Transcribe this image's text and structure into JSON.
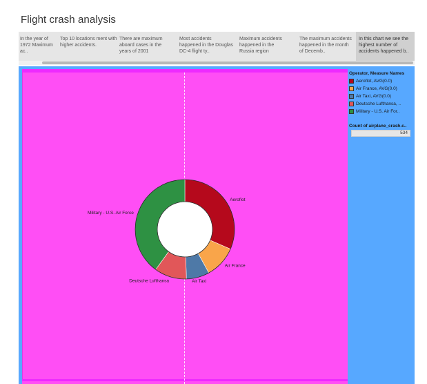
{
  "page": {
    "title": "Flight crash analysis"
  },
  "story": {
    "tabs": [
      {
        "text": "In the year of 1972 Maximum ac..",
        "active": false
      },
      {
        "text": "Top 10 locations  ment with higher accidents.",
        "active": false
      },
      {
        "text": "There are maximum aboard cases in the years of 2001",
        "active": false
      },
      {
        "text": "Most accidents happened in the Douglas DC-4 flight ty..",
        "active": false
      },
      {
        "text": "Maximum accidents happened  in the Russia region",
        "active": false
      },
      {
        "text": "The maximum accidents happened in the month of Decemb..",
        "active": false
      },
      {
        "text": "In this chart we see the highest number of accidents happened b..",
        "active": true
      }
    ]
  },
  "colors": {
    "plot_background": "#ff4ef5",
    "dashboard_background": "#57a8ff"
  },
  "legend": {
    "title": "Operator, Measure Names",
    "items": [
      {
        "label": "Aeroflot, AVG(0.0)",
        "color": "#b5091c"
      },
      {
        "label": "Air France, AVG(0.0)",
        "color": "#f9a54a"
      },
      {
        "label": "Air Taxi, AVG(0.0)",
        "color": "#4e79a7"
      },
      {
        "label": "Deutsche Lufthansa, ..",
        "color": "#e15759"
      },
      {
        "label": "Military - U.S. Air For..",
        "color": "#2e9143"
      }
    ]
  },
  "count_filter": {
    "title": "Count of airplane_crash.c..",
    "value": "534"
  },
  "chart_data": {
    "type": "pie",
    "donut": true,
    "categories": [
      "Aeroflot",
      "Air France",
      "Air Taxi",
      "Deutsche Lufthansa",
      "Military - U.S. Air Force"
    ],
    "values": [
      31.5,
      10.5,
      7.5,
      10.5,
      40
    ],
    "colors": [
      "#b5091c",
      "#f9a54a",
      "#4e79a7",
      "#e15759",
      "#2e9143"
    ]
  }
}
